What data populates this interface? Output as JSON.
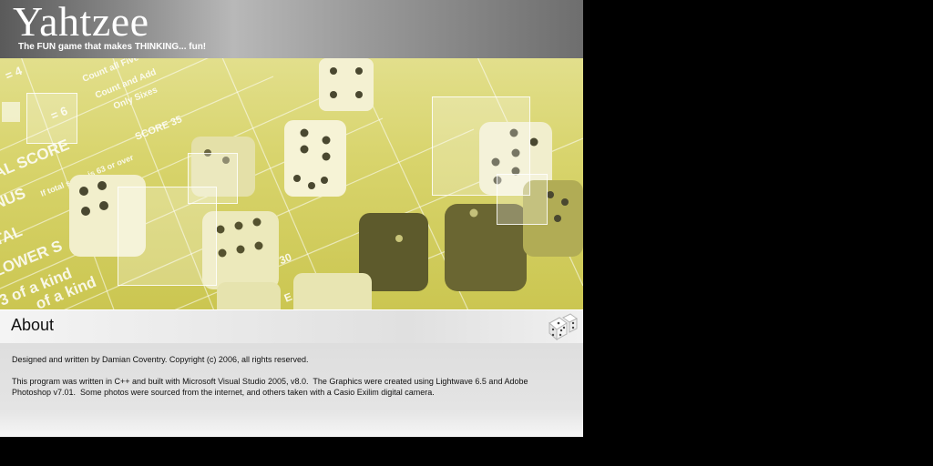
{
  "header": {
    "title": "Yahtzee",
    "tagline": "The FUN game that makes THINKING... fun!"
  },
  "scorecard_text": {
    "eq4": "= 4",
    "eq6": "= 6",
    "count_five": "Count all Five",
    "count_and_add": "Count and Add",
    "only_sixes": "Only Sixes",
    "score35": "SCORE 35",
    "total_score": "AL SCORE",
    "bonus": "NUS",
    "if_total": "If total score is 63 or over",
    "total": "TAL",
    "lower_section": "LOWER S",
    "three_kind": "3 of a kind",
    "of_a_kind": "of a kind",
    "score30": "RE 30",
    "score40": "E 40"
  },
  "about": {
    "title": "About",
    "credit": "Designed and written by Damian Coventry. Copyright (c) 2006, all rights reserved.",
    "tools": "This program was written in C++ and built with Microsoft Visual Studio 2005, v8.0.  The Graphics were created using Lightwave 6.5 and Adobe Photoshop v7.01.  Some photos were sourced from the internet, and others taken with a Casio Exilim digital camera."
  },
  "icons": {
    "dice": "dice-icon"
  }
}
